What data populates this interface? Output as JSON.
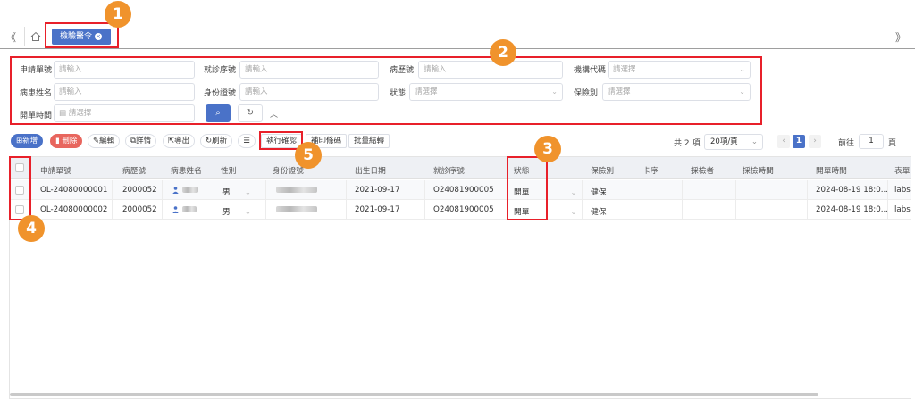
{
  "tabs": {
    "active_label": "檢驗醫令",
    "nav_left": "《",
    "nav_right": "》"
  },
  "form": {
    "labels": [
      "申請單號",
      "就診序號",
      "病歷號",
      "機構代碼",
      "病患姓名",
      "身份證號",
      "狀態",
      "保險別",
      "開單時間"
    ],
    "input_placeholder": "請輸入",
    "select_placeholder": "請選擇"
  },
  "toolbar": {
    "add": "新增",
    "delete": "刪除",
    "edit": "編輯",
    "detail": "詳情",
    "export": "導出",
    "refresh": "刷新",
    "execute_confirm": "執行確認",
    "print_barcode": "補印條碼",
    "batch_transfer": "批量結轉"
  },
  "pager": {
    "total": "共 2 項",
    "page_size": "20項/頁",
    "current_page": "1",
    "goto_label": "前往",
    "goto_value": "1",
    "page_unit": "頁"
  },
  "table": {
    "headers": [
      "申請單號",
      "病歷號",
      "病患姓名",
      "性別",
      "身份證號",
      "出生日期",
      "就診序號",
      "狀態",
      "保險別",
      "卡序",
      "採檢者",
      "採檢時間",
      "開單時間",
      "表單"
    ],
    "rows": [
      {
        "order_no": "OL-24080000001",
        "mrn": "2000052",
        "gender": "男",
        "birth": "2021-09-17",
        "visit_no": "O24081900005",
        "status": "開單",
        "insurance": "健保",
        "open_time": "2024-08-19 18:0...",
        "form": "labs"
      },
      {
        "order_no": "OL-24080000002",
        "mrn": "2000052",
        "gender": "男",
        "birth": "2021-09-17",
        "visit_no": "O24081900005",
        "status": "開單",
        "insurance": "健保",
        "open_time": "2024-08-19 18:0...",
        "form": "labs"
      }
    ]
  },
  "callouts": [
    "1",
    "2",
    "3",
    "4",
    "5"
  ],
  "colors": {
    "primary": "#4a72c8",
    "danger": "#e8665e",
    "highlight": "#e8202a",
    "badge": "#f0932c"
  }
}
